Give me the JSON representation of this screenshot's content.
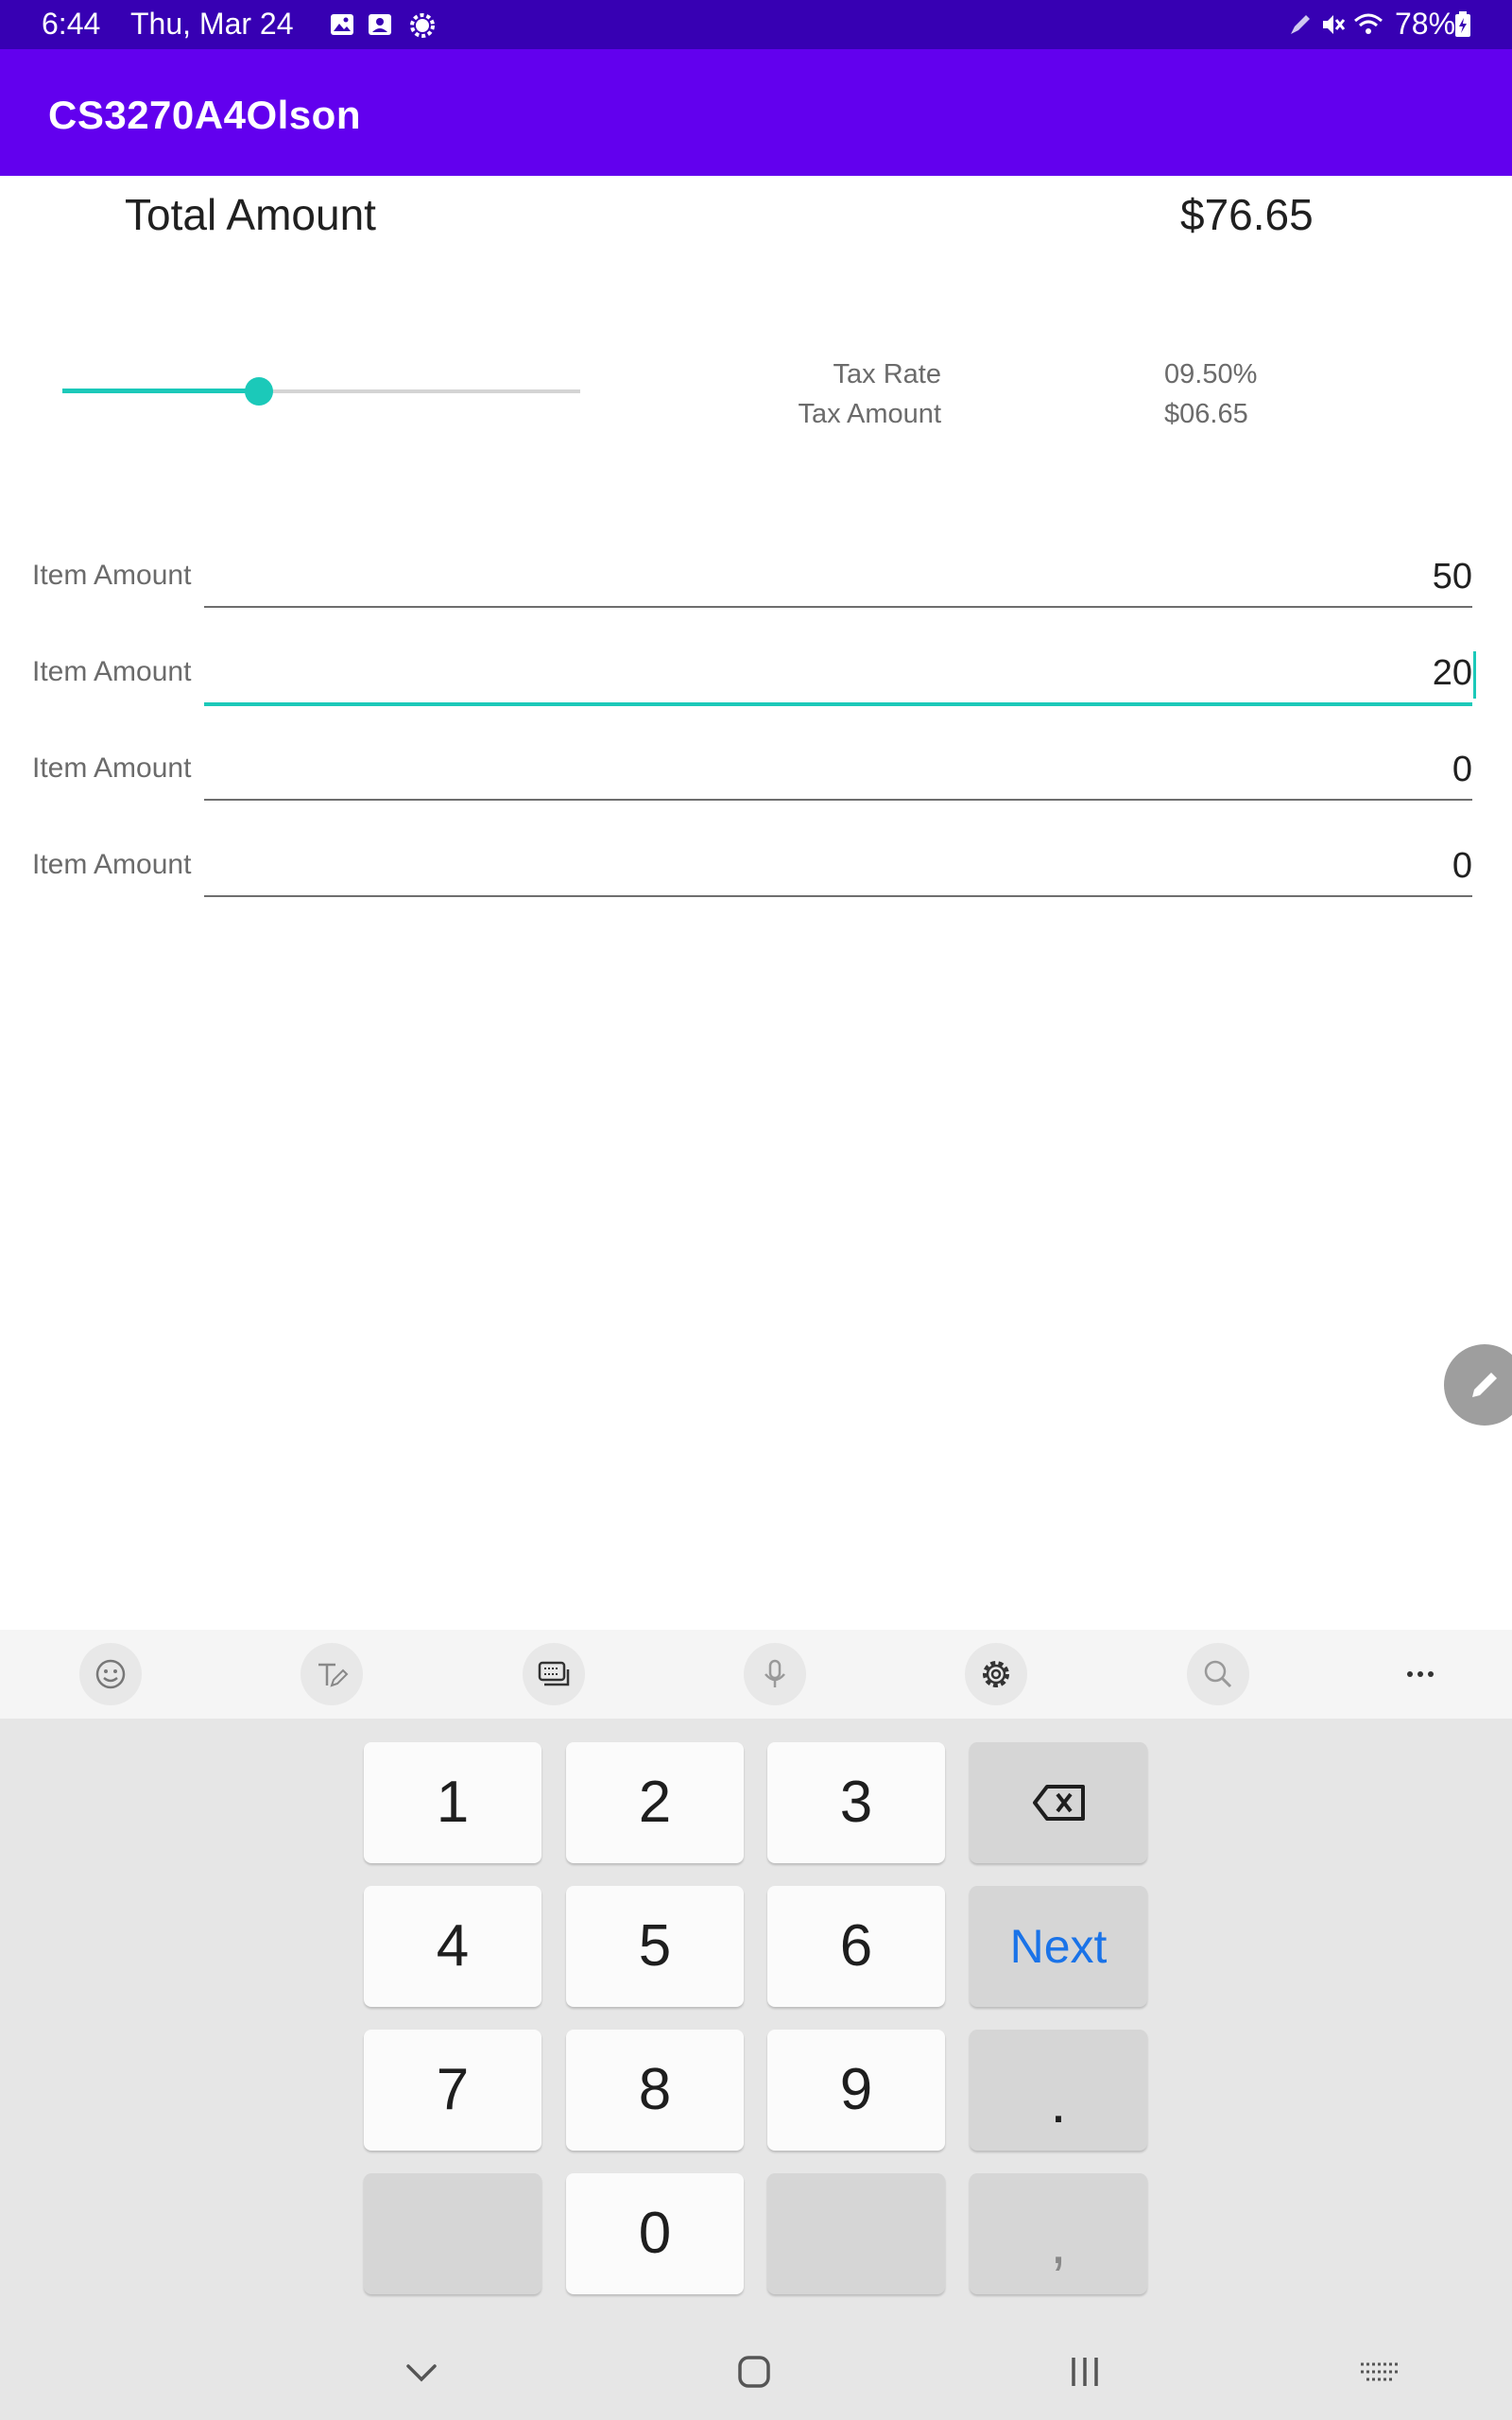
{
  "status_bar": {
    "time": "6:44",
    "date": "Thu, Mar 24",
    "battery": "78%",
    "icons": [
      "gallery-icon",
      "screenshot-icon",
      "settings-gear-icon",
      "pen-icon",
      "mute-icon",
      "wifi-icon",
      "battery-icon"
    ]
  },
  "app_bar": {
    "title": "CS3270A4Olson"
  },
  "total": {
    "label": "Total Amount",
    "value": "$76.65"
  },
  "tax": {
    "slider_fraction": 0.38,
    "rate_label": "Tax Rate",
    "rate_value": "09.50%",
    "amount_label": "Tax Amount",
    "amount_value": "$06.65"
  },
  "items": [
    {
      "label": "Item Amount",
      "value": "50",
      "focused": false
    },
    {
      "label": "Item Amount",
      "value": "20",
      "focused": true
    },
    {
      "label": "Item Amount",
      "value": "0",
      "focused": false
    },
    {
      "label": "Item Amount",
      "value": "0",
      "focused": false
    }
  ],
  "fab": {
    "icon": "pencil-icon"
  },
  "keyboard_toolbar": {
    "buttons": [
      "emoji-icon",
      "handwriting-icon",
      "keyboard-mode-icon",
      "microphone-icon",
      "settings-icon",
      "search-icon",
      "more-icon"
    ]
  },
  "keyboard": {
    "keys": [
      "1",
      "2",
      "3",
      "4",
      "5",
      "6",
      "7",
      "8",
      "9",
      "0"
    ],
    "next_label": "Next",
    "period_label": ".",
    "comma_label": ","
  },
  "nav_bar": {
    "buttons": [
      "back-chevron-icon",
      "home-icon",
      "recents-icon",
      "keyboard-switch-icon"
    ]
  },
  "colors": {
    "status_bar": "#3700b3",
    "app_bar": "#6200ee",
    "accent": "#1bc9b9",
    "next_key": "#1a73e8"
  }
}
